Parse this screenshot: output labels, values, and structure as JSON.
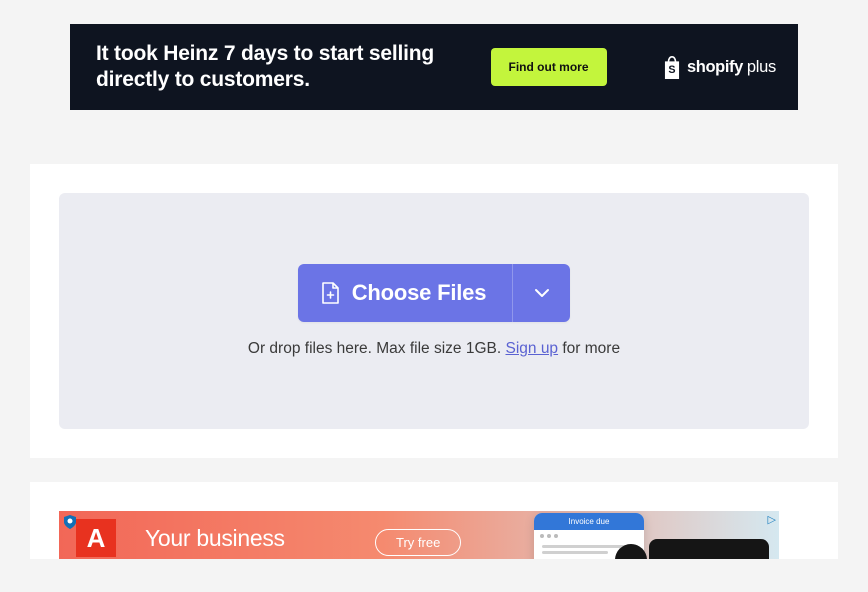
{
  "ads": {
    "top": {
      "headline": "It took Heinz 7 days to start selling directly to customers.",
      "cta": "Find out more",
      "brand": "shopify",
      "brand_suffix": "plus"
    },
    "bottom": {
      "headline": "Your business",
      "cta": "Try free",
      "window_title": "Invoice due"
    }
  },
  "upload": {
    "choose_label": "Choose Files",
    "drop_prefix": "Or drop files here. Max file size 1GB. ",
    "signup_text": "Sign up",
    "drop_suffix": " for more"
  }
}
